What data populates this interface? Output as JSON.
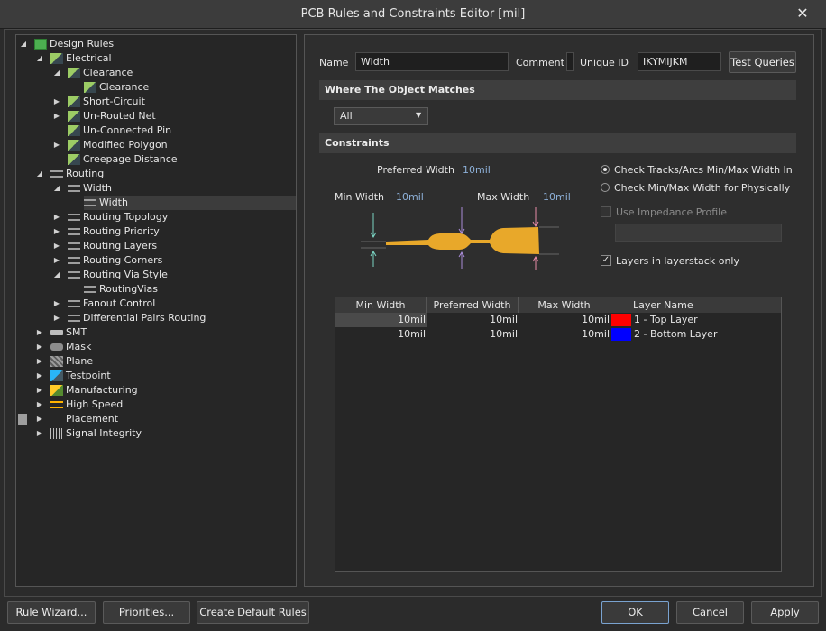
{
  "window": {
    "title": "PCB Rules and Constraints Editor [mil]",
    "close_glyph": "✕"
  },
  "tree": {
    "items": [
      {
        "label": "Design Rules",
        "icon": "design-rules-icon",
        "arrow": "◢",
        "depth": 0
      },
      {
        "label": "Electrical",
        "icon": "electrical-icon",
        "arrow": "◢",
        "depth": 1
      },
      {
        "label": "Clearance",
        "icon": "clearance-icon",
        "arrow": "◢",
        "depth": 2
      },
      {
        "label": "Clearance",
        "icon": "clearance-rule-icon",
        "arrow": "",
        "depth": 3
      },
      {
        "label": "Short-Circuit",
        "icon": "short-circuit-icon",
        "arrow": "▶",
        "depth": 2
      },
      {
        "label": "Un-Routed Net",
        "icon": "unrouted-net-icon",
        "arrow": "▶",
        "depth": 2
      },
      {
        "label": "Un-Connected Pin",
        "icon": "unconnected-pin-icon",
        "arrow": "",
        "depth": 2
      },
      {
        "label": "Modified Polygon",
        "icon": "modified-polygon-icon",
        "arrow": "▶",
        "depth": 2
      },
      {
        "label": "Creepage Distance",
        "icon": "creepage-distance-icon",
        "arrow": "",
        "depth": 2
      },
      {
        "label": "Routing",
        "icon": "routing-icon",
        "arrow": "◢",
        "depth": 1
      },
      {
        "label": "Width",
        "icon": "width-icon",
        "arrow": "◢",
        "depth": 2
      },
      {
        "label": "Width",
        "icon": "width-rule-icon",
        "arrow": "",
        "depth": 3,
        "selected": true
      },
      {
        "label": "Routing Topology",
        "icon": "routing-topology-icon",
        "arrow": "▶",
        "depth": 2
      },
      {
        "label": "Routing Priority",
        "icon": "routing-priority-icon",
        "arrow": "▶",
        "depth": 2
      },
      {
        "label": "Routing Layers",
        "icon": "routing-layers-icon",
        "arrow": "▶",
        "depth": 2
      },
      {
        "label": "Routing Corners",
        "icon": "routing-corners-icon",
        "arrow": "▶",
        "depth": 2
      },
      {
        "label": "Routing Via Style",
        "icon": "routing-via-style-icon",
        "arrow": "◢",
        "depth": 2
      },
      {
        "label": "RoutingVias",
        "icon": "routing-vias-rule-icon",
        "arrow": "",
        "depth": 3
      },
      {
        "label": "Fanout Control",
        "icon": "fanout-control-icon",
        "arrow": "▶",
        "depth": 2
      },
      {
        "label": "Differential Pairs Routing",
        "icon": "differential-pairs-icon",
        "arrow": "▶",
        "depth": 2
      },
      {
        "label": "SMT",
        "icon": "smt-icon",
        "arrow": "▶",
        "depth": 1
      },
      {
        "label": "Mask",
        "icon": "mask-icon",
        "arrow": "▶",
        "depth": 1
      },
      {
        "label": "Plane",
        "icon": "plane-icon",
        "arrow": "▶",
        "depth": 1
      },
      {
        "label": "Testpoint",
        "icon": "testpoint-icon",
        "arrow": "▶",
        "depth": 1
      },
      {
        "label": "Manufacturing",
        "icon": "manufacturing-icon",
        "arrow": "▶",
        "depth": 1
      },
      {
        "label": "High Speed",
        "icon": "high-speed-icon",
        "arrow": "▶",
        "depth": 1
      },
      {
        "label": "Placement",
        "icon": "placement-icon",
        "arrow": "▶",
        "depth": 1
      },
      {
        "label": "Signal Integrity",
        "icon": "signal-integrity-icon",
        "arrow": "▶",
        "depth": 1
      }
    ]
  },
  "rule": {
    "name_label": "Name",
    "name_value": "Width",
    "comment_label": "Comment",
    "comment_value": "",
    "unique_id_label": "Unique ID",
    "unique_id_value": "IKYMIJKM",
    "test_queries_button": "Test Queries"
  },
  "where": {
    "header": "Where The Object Matches",
    "select_value": "All"
  },
  "constraints": {
    "header": "Constraints",
    "preferred_width_label": "Preferred Width",
    "preferred_width_value": "10mil",
    "min_width_label": "Min Width",
    "min_width_value": "10mil",
    "max_width_label": "Max Width",
    "max_width_value": "10mil",
    "radio_check_tracks": "Check Tracks/Arcs Min/Max Width In",
    "radio_check_physically": "Check Min/Max Width for Physically",
    "use_impedance_profile": "Use Impedance Profile",
    "layers_in_layerstack_only": "Layers in layerstack only",
    "selected_radio": "check_tracks",
    "layers_in_layerstack_checked": true,
    "use_impedance_checked": false
  },
  "layer_grid": {
    "headers": [
      "Min Width",
      "Preferred Width",
      "Max Width",
      "Layer Name"
    ],
    "rows": [
      {
        "min": "10mil",
        "preferred": "10mil",
        "max": "10mil",
        "color": "#ff0000",
        "layer": "1 - Top Layer"
      },
      {
        "min": "10mil",
        "preferred": "10mil",
        "max": "10mil",
        "color": "#0000ff",
        "layer": "2 - Bottom Layer"
      }
    ]
  },
  "buttons": {
    "rule_wizard": "Rule Wizard...",
    "priorities": "Priorities...",
    "create_default_rules": "Create Default Rules",
    "ok": "OK",
    "cancel": "Cancel",
    "apply": "Apply"
  },
  "colors": {
    "track_fill": "#e8a82a",
    "min_arrow": "#7ad4c2",
    "preferred_arrow": "#a98cd8",
    "max_arrow": "#e88ca8"
  }
}
